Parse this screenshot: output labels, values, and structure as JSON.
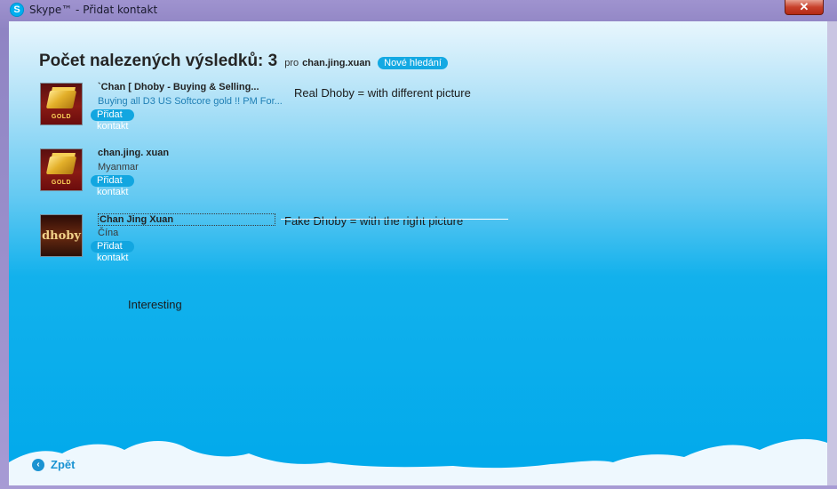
{
  "window": {
    "title": "Skype™ - Přidat kontakt",
    "close_label": "✕"
  },
  "heading": {
    "title": "Počet nalezených výsledků: 3",
    "pro": "pro",
    "query": "chan.jing.xuan",
    "new_search": "Nové hledání"
  },
  "results": [
    {
      "name": "`Chan [ Dhoby - Buying & Selling...",
      "subtitle": "Buying all D3 US Softcore gold !! PM For...",
      "add_label": "Přidat kontakt",
      "avatar_text": "GOLD"
    },
    {
      "name": "chan.jing. xuan",
      "subtitle": "Myanmar",
      "add_label": "Přidat kontakt",
      "avatar_text": "GOLD"
    },
    {
      "name": "Chan Jing Xuan",
      "subtitle": "Čína",
      "add_label": "Přidat kontakt",
      "avatar_text": "dhoby"
    }
  ],
  "notes": {
    "real": "Real Dhoby  = with different picture",
    "fake": "Fake Dhoby = with the right picture",
    "interesting": "Interesting"
  },
  "footer": {
    "back_icon": "‹",
    "back_label": "Zpět"
  },
  "colors": {
    "accent": "#00a9eb",
    "button": "#12a6e0",
    "back_link": "#1a93d2"
  }
}
